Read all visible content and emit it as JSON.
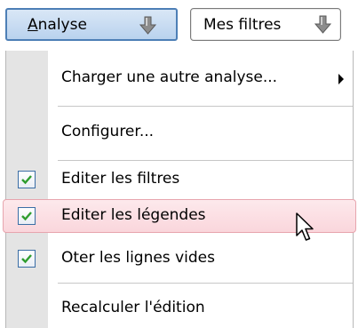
{
  "toolbar": {
    "analyse": {
      "accesskey": "A",
      "label_rest": "nalyse",
      "arrow_icon": "down-arrow-icon"
    },
    "mes_filtres": {
      "label": "Mes filtres",
      "arrow_icon": "down-arrow-icon"
    }
  },
  "menu": {
    "items": [
      {
        "label": "Charger une autre analyse...",
        "has_submenu": true,
        "checked": false
      },
      {
        "label": "Configurer...",
        "checked": false
      },
      {
        "label": "Editer les filtres",
        "checked": true
      },
      {
        "label": "Editer les légendes",
        "checked": true,
        "hovered": true
      },
      {
        "label": "Oter les lignes vides",
        "checked": true
      },
      {
        "label": "Recalculer l'édition",
        "checked": false
      }
    ]
  },
  "colors": {
    "active_button_border": "#4d7fb6",
    "check_green": "#2f9d2f",
    "hover_background": "#fad6dc",
    "gutter": "#e4e4e4"
  }
}
